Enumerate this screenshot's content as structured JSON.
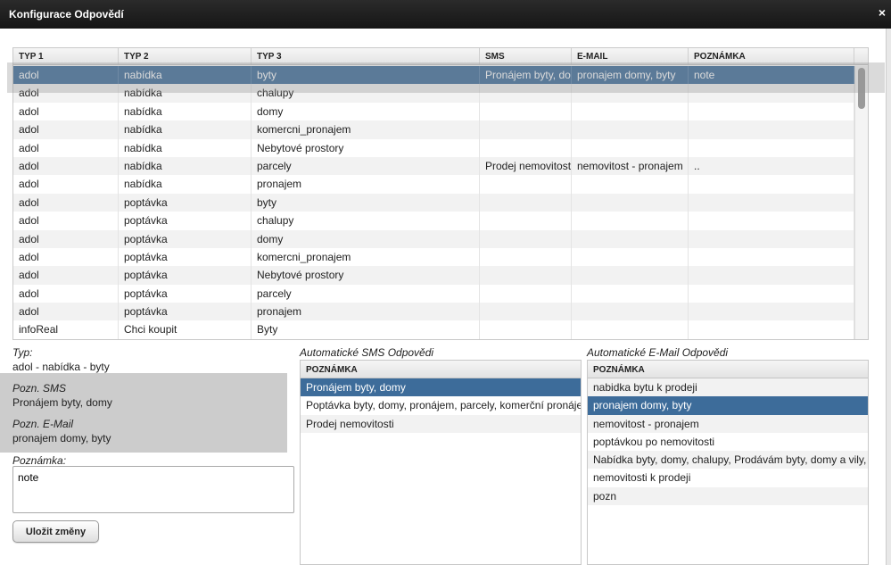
{
  "window": {
    "title": "Konfigurace Odpovědí",
    "close_glyph": "×"
  },
  "grid": {
    "columns": [
      "TYP 1",
      "TYP 2",
      "TYP 3",
      "SMS",
      "E-MAIL",
      "POZNÁMKA"
    ],
    "rows": [
      [
        "adol",
        "nabídka",
        "byty",
        "Pronájem byty, domy",
        "pronajem domy, byty",
        "note"
      ],
      [
        "adol",
        "nabídka",
        "chalupy",
        "",
        "",
        ""
      ],
      [
        "adol",
        "nabídka",
        "domy",
        "",
        "",
        ""
      ],
      [
        "adol",
        "nabídka",
        "komercni_pronajem",
        "",
        "",
        ""
      ],
      [
        "adol",
        "nabídka",
        "Nebytové prostory",
        "",
        "",
        ""
      ],
      [
        "adol",
        "nabídka",
        "parcely",
        "Prodej nemovitosti",
        "nemovitost - pronajem",
        ".."
      ],
      [
        "adol",
        "nabídka",
        "pronajem",
        "",
        "",
        ""
      ],
      [
        "adol",
        "poptávka",
        "byty",
        "",
        "",
        ""
      ],
      [
        "adol",
        "poptávka",
        "chalupy",
        "",
        "",
        ""
      ],
      [
        "adol",
        "poptávka",
        "domy",
        "",
        "",
        ""
      ],
      [
        "adol",
        "poptávka",
        "komercni_pronajem",
        "",
        "",
        ""
      ],
      [
        "adol",
        "poptávka",
        "Nebytové prostory",
        "",
        "",
        ""
      ],
      [
        "adol",
        "poptávka",
        "parcely",
        "",
        "",
        ""
      ],
      [
        "adol",
        "poptávka",
        "pronajem",
        "",
        "",
        ""
      ],
      [
        "infoReal",
        "Chci koupit",
        "Byty",
        "",
        "",
        ""
      ]
    ],
    "selected_row": 0
  },
  "detail": {
    "typ_label": "Typ:",
    "typ_value": "adol - nabídka - byty",
    "sms_label": "Pozn. SMS",
    "sms_value": "Pronájem byty, domy",
    "email_label": "Pozn. E-Mail",
    "email_value": "pronajem domy, byty",
    "poznamka_label": "Poznámka:",
    "poznamka_value": "note",
    "save_label": "Uložit změny"
  },
  "sms_list": {
    "title": "Automatické SMS Odpovědi",
    "header": "POZNÁMKA",
    "items": [
      "Pronájem byty, domy",
      "Poptávka byty, domy, pronájem, parcely, komerční pronájem",
      "Prodej nemovitosti"
    ],
    "selected": 0
  },
  "email_list": {
    "title": "Automatické E-Mail Odpovědi",
    "header": "POZNÁMKA",
    "items": [
      "nabidka bytu k prodeji",
      "pronajem domy, byty",
      "nemovitost - pronajem",
      "poptávkou po nemovitosti",
      "Nabídka byty, domy, chalupy, Prodávám byty, domy a vily,",
      "nemovitosti k prodeji",
      "pozn"
    ],
    "selected": 1
  },
  "colors": {
    "selection": "#3d6c9a",
    "titlebar": "#1e1e1e"
  }
}
